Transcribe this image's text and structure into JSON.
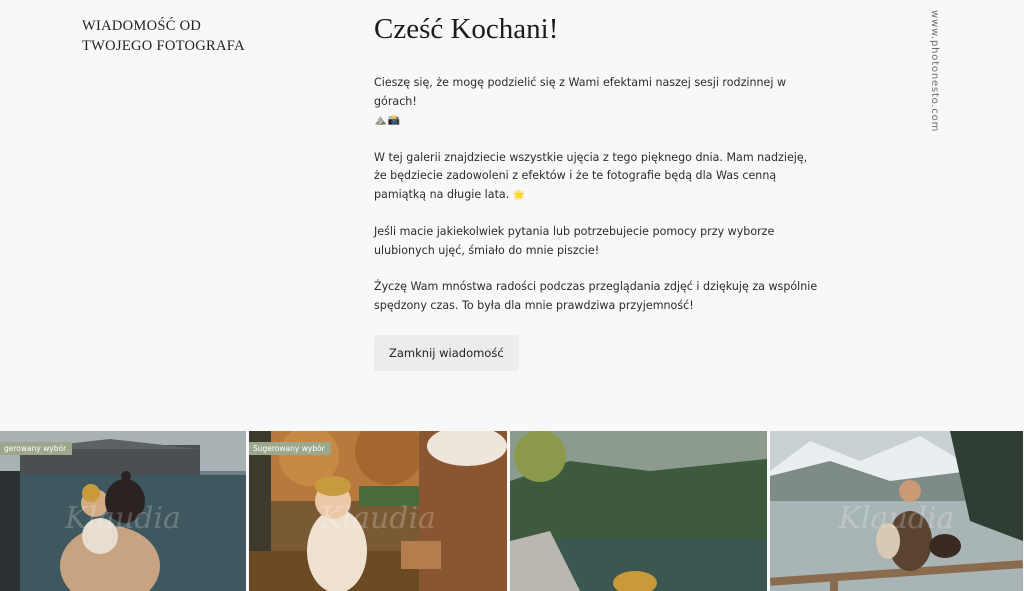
{
  "sender": {
    "line1": "Wiadomość od",
    "line2": "Twojego fotografa"
  },
  "domain": "www.photonesto.com",
  "message": {
    "greeting": "Cześć Kochani!",
    "paragraphs": [
      {
        "text": "Cieszę się, że mogę podzielić się z Wami efektami naszej sesji rodzinnej w górach!",
        "emoji": "⛰️📸"
      },
      {
        "text": "W tej galerii znajdziecie wszystkie ujęcia z tego pięknego dnia. Mam nadzieję, że będziecie zadowoleni z efektów i że te fotografie będą dla Was cenną pamiątką na długie lata.",
        "emoji": "🌟"
      },
      {
        "text": "Jeśli macie jakiekolwiek pytania lub potrzebujecie pomocy przy wyborze ulubionych ujęć, śmiało do mnie piszcie!",
        "emoji": ""
      },
      {
        "text": "Życzę Wam mnóstwa radości podczas przeglądania zdjęć i dziękuję za wspólnie spędzony czas. To była dla mnie prawdziwa przyjemność!",
        "emoji": ""
      }
    ],
    "close_label": "Zamknij wiadomość"
  },
  "gallery": {
    "photos": [
      {
        "badge": "gerowany wybór",
        "watermark": "Klaudia"
      },
      {
        "badge": "Sugerowany wybór",
        "watermark": "Klaudia"
      },
      {
        "badge": "",
        "watermark": ""
      },
      {
        "badge": "",
        "watermark": "Klaudia"
      }
    ]
  }
}
